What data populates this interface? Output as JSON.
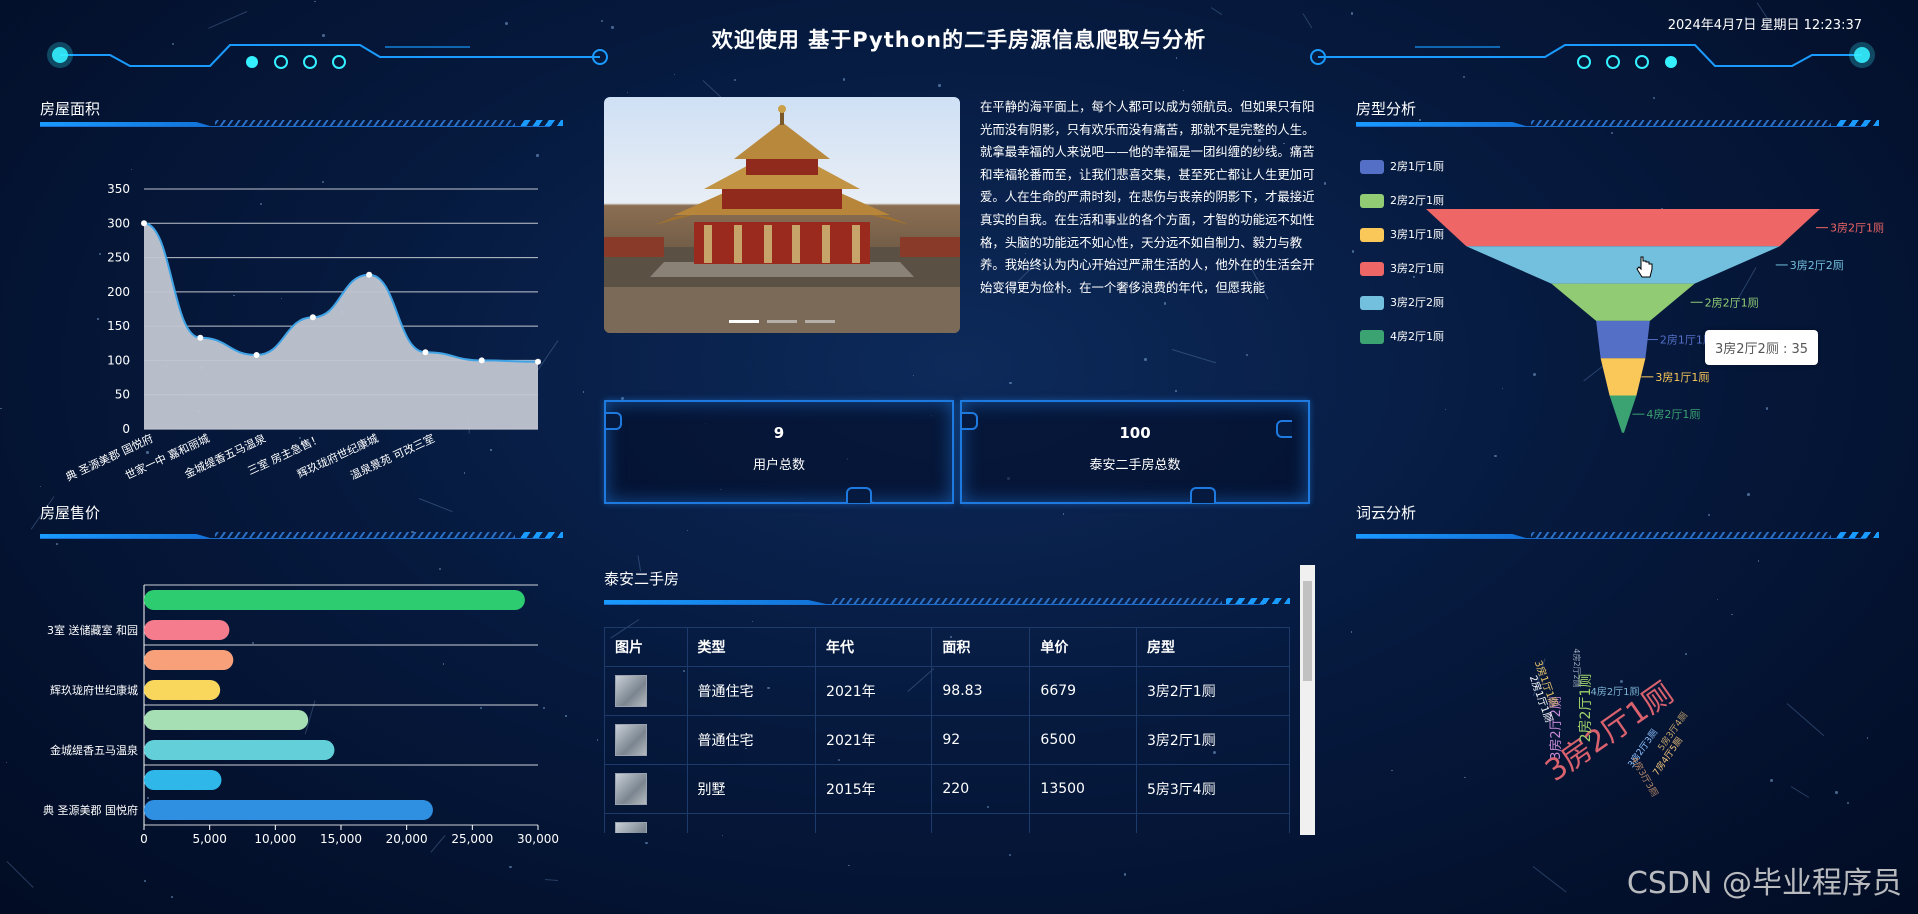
{
  "header": {
    "title": "欢迎使用 基于Python的二手房源信息爬取与分析",
    "datetime": "2024年4月7日 星期日 12:23:37"
  },
  "panels": {
    "area_title": "房屋面积",
    "price_title": "房屋售价",
    "type_title": "房型分析",
    "wordcloud_title": "词云分析",
    "table_title": "泰安二手房"
  },
  "intro_text": "在平静的海平面上，每个人都可以成为领航员。但如果只有阳光而没有阴影，只有欢乐而没有痛苦，那就不是完整的人生。就拿最幸福的人来说吧——他的幸福是一团纠缠的纱线。痛苦和幸福轮番而至，让我们悲喜交集，甚至死亡都让人生更加可爱。人在生命的严肃时刻，在悲伤与丧亲的阴影下，才最接近真实的自我。在生活和事业的各个方面，才智的功能远不如性格，头脑的功能远不如心性，天分远不如自制力、毅力与教养。我始终认为内心开始过严肃生活的人，他外在的生活会开始变得更为俭朴。在一个奢侈浪费的年代，但愿我能",
  "stats": [
    {
      "value": "9",
      "label": "用户总数"
    },
    {
      "value": "100",
      "label": "泰安二手房总数"
    }
  ],
  "table": {
    "headers": [
      "图片",
      "类型",
      "年代",
      "面积",
      "单价",
      "房型"
    ],
    "rows": [
      [
        "",
        "普通住宅",
        "2021年",
        "98.83",
        "6679",
        "3房2厅1厕"
      ],
      [
        "",
        "普通住宅",
        "2021年",
        "92",
        "6500",
        "3房2厅1厕"
      ],
      [
        "",
        "别墅",
        "2015年",
        "220",
        "13500",
        "5房3厅4厕"
      ]
    ]
  },
  "tooltip": "3房2厅2厕 : 35",
  "watermark": "CSDN @毕业程序员",
  "colors": {
    "accent": "#1a9bff",
    "area_fill": "#c2c6d2",
    "area_line": "#3fa3e6"
  },
  "chart_data": [
    {
      "type": "area",
      "title": "房屋面积",
      "categories": [
        "典 圣源美郡 国悦府",
        "世家一中 嘉和丽城",
        "金城缇香五马温泉",
        "三室 房主急售！",
        "辉玖珑府世纪康城",
        "温泉景苑 可改三室",
        "",
        ""
      ],
      "x_labels": [
        "典 圣源美郡 国悦府",
        "世家一中 嘉和丽城",
        "金城缇香五马温泉",
        "三室 房主急售！",
        "辉玖珑府世纪康城",
        "温泉景苑 可改三室"
      ],
      "values": [
        300,
        133,
        108,
        163,
        225,
        112,
        100,
        98
      ],
      "ylim": [
        0,
        350
      ],
      "yticks": [
        "350",
        "300",
        "250",
        "200",
        "150",
        "100",
        "50",
        "0"
      ]
    },
    {
      "type": "bar",
      "orientation": "horizontal",
      "title": "房屋售价",
      "y_labels": [
        "3室 送储藏室 和园",
        "辉玖珑府世纪康城",
        "金城缇香五马温泉",
        "典 圣源美郡 国悦府"
      ],
      "values": [
        29000,
        6500,
        6800,
        5800,
        12500,
        14500,
        5900,
        22000
      ],
      "colors": [
        "#2ecc71",
        "#f47c8c",
        "#f8a07a",
        "#f9d65c",
        "#a5dfb3",
        "#63d0d9",
        "#2fb7ea",
        "#2f8fe0"
      ],
      "xlim": [
        0,
        30000
      ],
      "xticks": [
        "0",
        "5,000",
        "10,000",
        "15,000",
        "20,000",
        "25,000",
        "30,000"
      ]
    },
    {
      "type": "funnel",
      "title": "房型分析",
      "legend": [
        "2房1厅1厕",
        "2房2厅1厕",
        "3房1厅1厕",
        "3房2厅1厕",
        "3房2厅2厕",
        "4房2厅1厕"
      ],
      "series": [
        {
          "name": "3房2厅1厕",
          "value": 44,
          "color": "#ee6666"
        },
        {
          "name": "3房2厅2厕",
          "value": 35,
          "color": "#73c0de"
        },
        {
          "name": "2房2厅1厕",
          "value": 16,
          "color": "#91cc75"
        },
        {
          "name": "2房1厅1厕",
          "value": 6,
          "color": "#5470c6"
        },
        {
          "name": "3房1厅1厕",
          "value": 5,
          "color": "#fac858"
        },
        {
          "name": "4房2厅1厕",
          "value": 3,
          "color": "#3ba272"
        }
      ],
      "legend_colors": [
        "#5470c6",
        "#91cc75",
        "#fac858",
        "#ee6666",
        "#73c0de",
        "#3ba272"
      ]
    }
  ],
  "wordcloud": [
    "3房2厅1厕",
    "3房2厅2厕",
    "2房2厅1厕",
    "4房2厅1厕",
    "3房1厅1厕",
    "2房1厅1厕",
    "4房2厅2厕",
    "5房3厅4厕",
    "3房2厅3厕",
    "7房4厅5厕",
    "4房3厅3厕"
  ]
}
